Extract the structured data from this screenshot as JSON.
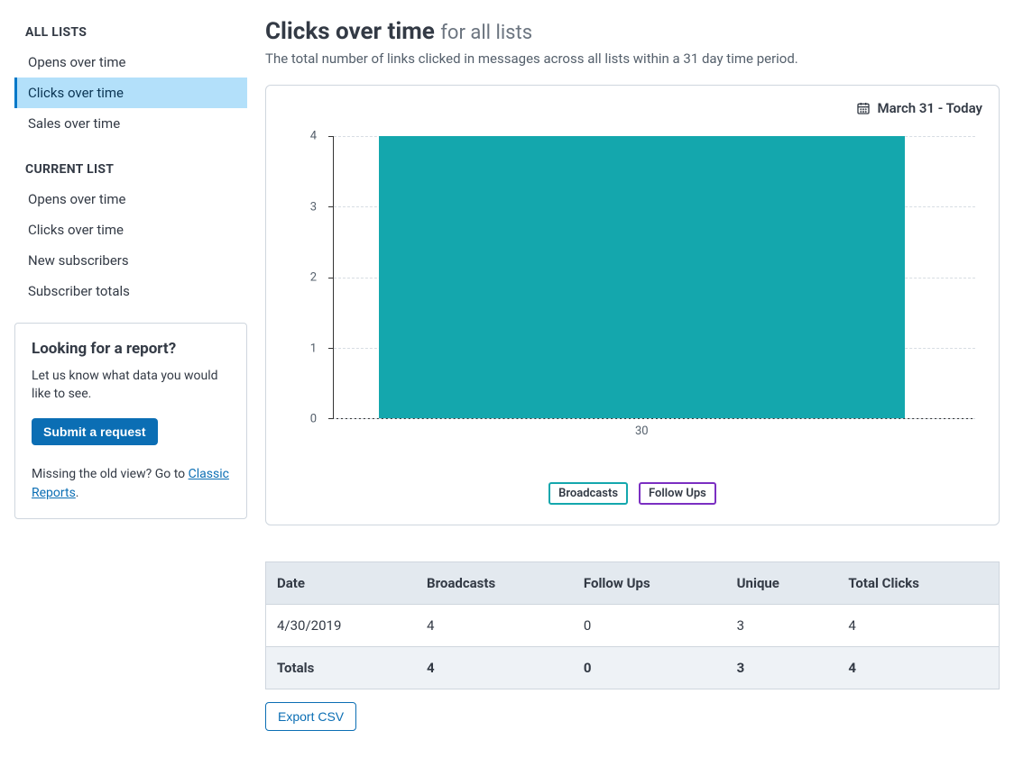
{
  "sidebar": {
    "all_lists_header": "ALL LISTS",
    "all_lists_items": [
      {
        "label": "Opens over time",
        "active": false
      },
      {
        "label": "Clicks over time",
        "active": true
      },
      {
        "label": "Sales over time",
        "active": false
      }
    ],
    "current_list_header": "CURRENT LIST",
    "current_list_items": [
      {
        "label": "Opens over time"
      },
      {
        "label": "Clicks over time"
      },
      {
        "label": "New subscribers"
      },
      {
        "label": "Subscriber totals"
      }
    ],
    "card": {
      "title": "Looking for a report?",
      "text": "Let us know what data you would like to see.",
      "button": "Submit a request",
      "foot_pre": "Missing the old view? Go to ",
      "foot_link": "Classic Reports",
      "foot_post": "."
    }
  },
  "page": {
    "title_main": "Clicks over time",
    "title_sub": "for all lists",
    "description": "The total number of links clicked in messages across all lists within a 31 day time period.",
    "date_range": "March 31 - Today"
  },
  "chart_data": {
    "type": "bar",
    "categories": [
      "30"
    ],
    "series": [
      {
        "name": "Broadcasts",
        "color": "#14a7ad",
        "values": [
          4
        ]
      },
      {
        "name": "Follow Ups",
        "color": "#7b2fc2",
        "values": [
          0
        ]
      }
    ],
    "ylim": [
      0,
      4
    ],
    "y_ticks": [
      0,
      1,
      2,
      3,
      4
    ],
    "xlabel": "",
    "ylabel": ""
  },
  "legend": {
    "broadcasts": "Broadcasts",
    "followups": "Follow Ups"
  },
  "table": {
    "headers": [
      "Date",
      "Broadcasts",
      "Follow Ups",
      "Unique",
      "Total Clicks"
    ],
    "rows": [
      {
        "cells": [
          "4/30/2019",
          "4",
          "0",
          "3",
          "4"
        ]
      }
    ],
    "totals": {
      "label": "Totals",
      "cells": [
        "4",
        "0",
        "3",
        "4"
      ]
    }
  },
  "export_label": "Export CSV"
}
